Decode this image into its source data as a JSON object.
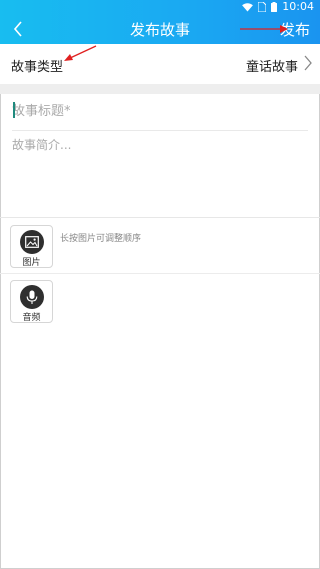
{
  "status": {
    "time": "10:04",
    "icons": [
      "wifi-icon",
      "sim-icon",
      "battery-icon"
    ]
  },
  "header": {
    "title": "发布故事",
    "publish_label": "发布",
    "back_icon": "chevron-left-icon",
    "color": "#1aa8f2"
  },
  "type_row": {
    "label": "故事类型",
    "value": "童话故事"
  },
  "form": {
    "title_placeholder": "故事标题*",
    "summary_placeholder": "故事简介..."
  },
  "media": {
    "image_label": "图片",
    "hint": "长按图片可调整顺序",
    "audio_label": "音频"
  },
  "annotations": {
    "arrow_color": "#e02020"
  }
}
